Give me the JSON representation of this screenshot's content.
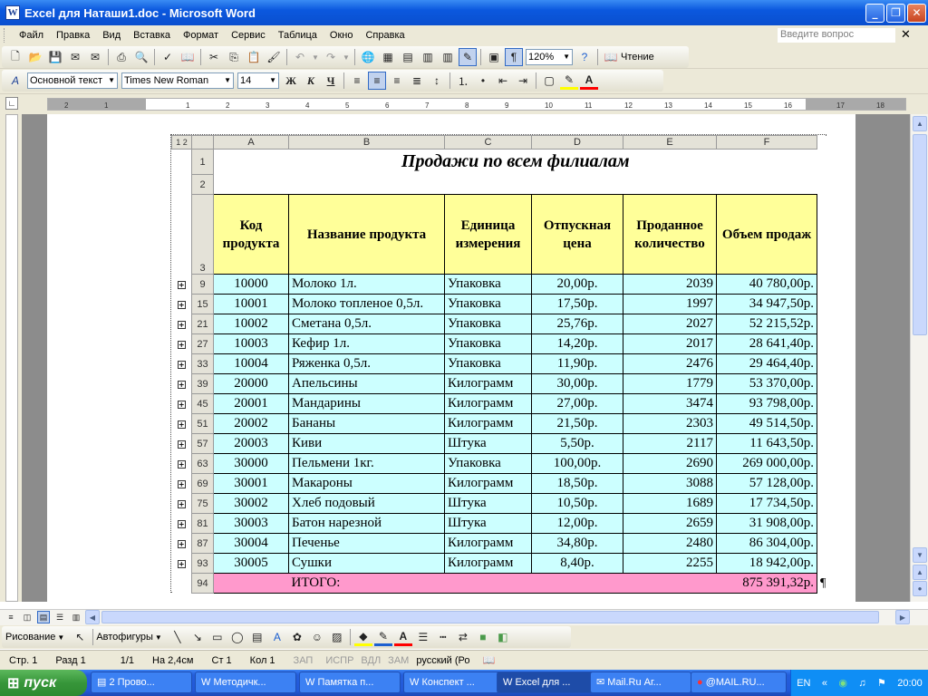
{
  "window": {
    "title": "Excel для Наташи1.doc - Microsoft Word",
    "app_icon": "W"
  },
  "menu": {
    "items": [
      "Файл",
      "Правка",
      "Вид",
      "Вставка",
      "Формат",
      "Сервис",
      "Таблица",
      "Окно",
      "Справка"
    ],
    "help_placeholder": "Введите вопрос"
  },
  "toolbar_standard": {
    "zoom": "120%",
    "read_label": "Чтение"
  },
  "toolbar_format": {
    "style": "Основной текст",
    "font": "Times New Roman",
    "size": "14",
    "bold": "Ж",
    "italic": "К",
    "underline": "Ч"
  },
  "ruler": {
    "ticks": [
      "2",
      "1",
      "1",
      "2",
      "3",
      "4",
      "5",
      "6",
      "7",
      "8",
      "9",
      "10",
      "11",
      "12",
      "13",
      "14",
      "15",
      "16",
      "17",
      "18"
    ]
  },
  "sheet": {
    "outline_levels": [
      "1",
      "2"
    ],
    "columns": [
      "A",
      "B",
      "C",
      "D",
      "E",
      "F"
    ],
    "title_row": "1",
    "blank_row": "2",
    "header_row": "3",
    "title": "Продажи по всем филиалам",
    "headers": [
      "Код продукта",
      "Название продукта",
      "Единица измерения",
      "Отпускная цена",
      "Проданное количество",
      "Объем продаж"
    ],
    "rows": [
      {
        "rn": "9",
        "code": "10000",
        "name": "Молоко 1л.",
        "unit": "Упаковка",
        "price": "20,00р.",
        "qty": "2039",
        "total": "40 780,00р."
      },
      {
        "rn": "15",
        "code": "10001",
        "name": "Молоко топленое 0,5л.",
        "unit": "Упаковка",
        "price": "17,50р.",
        "qty": "1997",
        "total": "34 947,50р."
      },
      {
        "rn": "21",
        "code": "10002",
        "name": "Сметана 0,5л.",
        "unit": "Упаковка",
        "price": "25,76р.",
        "qty": "2027",
        "total": "52 215,52р."
      },
      {
        "rn": "27",
        "code": "10003",
        "name": "Кефир 1л.",
        "unit": "Упаковка",
        "price": "14,20р.",
        "qty": "2017",
        "total": "28 641,40р."
      },
      {
        "rn": "33",
        "code": "10004",
        "name": "Ряженка 0,5л.",
        "unit": "Упаковка",
        "price": "11,90р.",
        "qty": "2476",
        "total": "29 464,40р."
      },
      {
        "rn": "39",
        "code": "20000",
        "name": "Апельсины",
        "unit": "Килограмм",
        "price": "30,00р.",
        "qty": "1779",
        "total": "53 370,00р."
      },
      {
        "rn": "45",
        "code": "20001",
        "name": "Мандарины",
        "unit": "Килограмм",
        "price": "27,00р.",
        "qty": "3474",
        "total": "93 798,00р."
      },
      {
        "rn": "51",
        "code": "20002",
        "name": "Бананы",
        "unit": "Килограмм",
        "price": "21,50р.",
        "qty": "2303",
        "total": "49 514,50р."
      },
      {
        "rn": "57",
        "code": "20003",
        "name": "Киви",
        "unit": "Штука",
        "price": "5,50р.",
        "qty": "2117",
        "total": "11 643,50р."
      },
      {
        "rn": "63",
        "code": "30000",
        "name": "Пельмени 1кг.",
        "unit": "Упаковка",
        "price": "100,00р.",
        "qty": "2690",
        "total": "269 000,00р."
      },
      {
        "rn": "69",
        "code": "30001",
        "name": "Макароны",
        "unit": "Килограмм",
        "price": "18,50р.",
        "qty": "3088",
        "total": "57 128,00р."
      },
      {
        "rn": "75",
        "code": "30002",
        "name": "Хлеб подовый",
        "unit": "Штука",
        "price": "10,50р.",
        "qty": "1689",
        "total": "17 734,50р."
      },
      {
        "rn": "81",
        "code": "30003",
        "name": "Батон нарезной",
        "unit": "Штука",
        "price": "12,00р.",
        "qty": "2659",
        "total": "31 908,00р."
      },
      {
        "rn": "87",
        "code": "30004",
        "name": "Печенье",
        "unit": "Килограмм",
        "price": "34,80р.",
        "qty": "2480",
        "total": "86 304,00р."
      },
      {
        "rn": "93",
        "code": "30005",
        "name": "Сушки",
        "unit": "Килограмм",
        "price": "8,40р.",
        "qty": "2255",
        "total": "18 942,00р."
      }
    ],
    "total_row": {
      "rn": "94",
      "label": "ИТОГО:",
      "total": "875 391,32р."
    }
  },
  "drawing_toolbar": {
    "draw": "Рисование",
    "autoshapes": "Автофигуры"
  },
  "status": {
    "page": "Стр. 1",
    "section": "Разд 1",
    "pages": "1/1",
    "at": "На 2,4см",
    "line": "Ст 1",
    "col": "Кол 1",
    "rec": "ЗАП",
    "trk": "ИСПР",
    "ext": "ВДЛ",
    "ovr": "ЗАМ",
    "lang": "русский (Ро"
  },
  "taskbar": {
    "start": "пуск",
    "tasks": [
      "2 Прово...",
      "Методичк...",
      "Памятка п...",
      "Конспект ...",
      "Excel для ...",
      "Mail.Ru Аг...",
      "@MAIL.RU..."
    ],
    "lang": "EN",
    "clock": "20:00"
  },
  "colors": {
    "header_fill": "#ffff99",
    "data_fill": "#ccffff",
    "total_fill": "#ff99cc",
    "titlebar": "#0b58de",
    "taskbar": "#245edb"
  }
}
